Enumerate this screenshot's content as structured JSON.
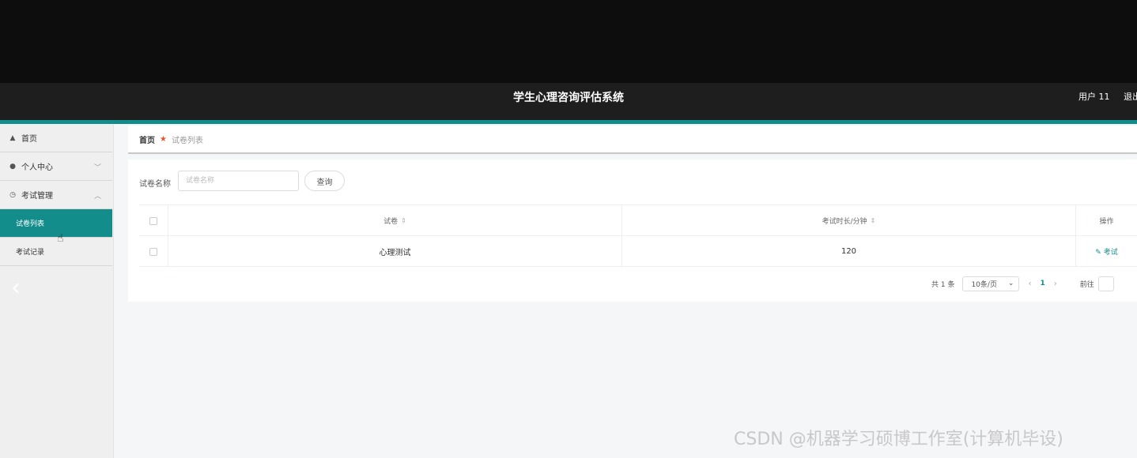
{
  "header": {
    "title": "学生心理咨询评估系统",
    "user": "用户 11",
    "logout": "退出"
  },
  "sidebar": {
    "items": [
      {
        "label": "首页",
        "icon": "home-icon"
      },
      {
        "label": "个人中心",
        "icon": "user-icon",
        "chevron": "﹀"
      },
      {
        "label": "考试管理",
        "icon": "clock-icon",
        "chevron": "︿"
      }
    ],
    "sub_items": [
      {
        "label": "试卷列表",
        "active": true
      },
      {
        "label": "考试记录",
        "active": false
      }
    ],
    "back_arrow": "‹"
  },
  "breadcrumb": {
    "home": "首页",
    "current": "试卷列表"
  },
  "search": {
    "label": "试卷名称",
    "placeholder": "试卷名称",
    "button": "查询"
  },
  "table": {
    "columns": [
      "试卷",
      "考试时长/分钟",
      "操作"
    ],
    "rows": [
      {
        "name": "心理测试",
        "duration": "120",
        "action": "考试"
      }
    ]
  },
  "pagination": {
    "total": "共 1 条",
    "page_size": "10条/页",
    "current": "1",
    "goto": "前往"
  },
  "watermark": "CSDN @机器学习硕博工作室(计算机毕设)",
  "colors": {
    "accent": "#138c8c",
    "header_bg": "#1e1e1e",
    "breadcrumb_star": "#e8532b"
  }
}
